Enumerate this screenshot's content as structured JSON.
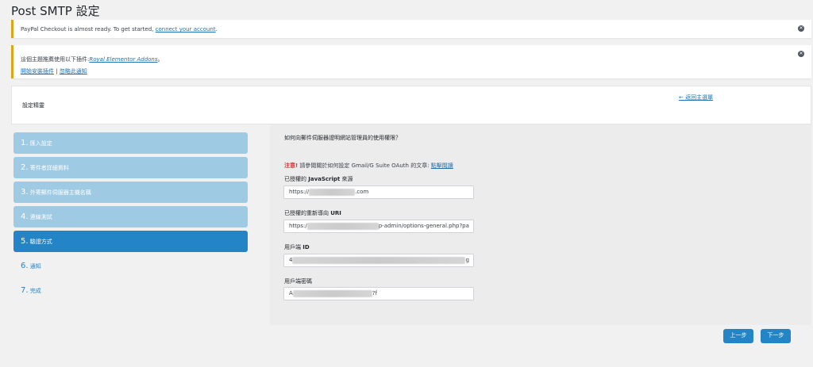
{
  "page": {
    "title": "Post SMTP 設定"
  },
  "notices": {
    "paypal": {
      "text": "PayPal Checkout is almost ready. To get started, ",
      "link": "connect your account",
      "suffix": "."
    },
    "theme": {
      "text": "這個主題推薦使用以下插件:",
      "plugin": "Royal Elementor Addons",
      "suffix": "。",
      "install": "開始安裝插件",
      "separator": " | ",
      "dismiss": "忽略此通知"
    }
  },
  "wizard": {
    "label": "設定精靈",
    "back": "← 返回主選單"
  },
  "steps": [
    {
      "num": "1.",
      "label": "匯入設定",
      "state": "done"
    },
    {
      "num": "2.",
      "label": "寄件者詳細資料",
      "state": "done"
    },
    {
      "num": "3.",
      "label": "外寄郵件伺服器主機名稱",
      "state": "done"
    },
    {
      "num": "4.",
      "label": "連線測試",
      "state": "done"
    },
    {
      "num": "5.",
      "label": "驗證方式",
      "state": "active"
    },
    {
      "num": "6.",
      "label": "通知",
      "state": "todo"
    },
    {
      "num": "7.",
      "label": "完成",
      "state": "todo"
    }
  ],
  "panel": {
    "question": "如何向郵件伺服器證明網站管理員的使用權限？",
    "note_warn": "注意!",
    "note_text": " 請參閱關於如何設定 Gmail/G Suite OAuth 的文章: ",
    "note_link": "點擊閱讀",
    "js_origin": {
      "label_prefix": "已授權的 ",
      "label_bold": "JavaScript",
      "label_suffix": " 來源",
      "value_start": "https://",
      "value_end": ".com"
    },
    "redirect": {
      "label_prefix": "已授權的重新導向 ",
      "label_bold": "URI",
      "value_start": "https:/",
      "value_end": "p-admin/options-general.php?pa"
    },
    "client_id": {
      "label_prefix": "用戶端 ",
      "label_bold": "ID",
      "value_start": "4",
      "value_end": "g"
    },
    "client_secret": {
      "label": "用戶端密碼",
      "value_start": "A",
      "value_end": "?f"
    }
  },
  "buttons": {
    "prev": "上一步",
    "next": "下一步"
  },
  "colors": {
    "step_done": "#9ecae3",
    "step_active": "#2384c6",
    "notice_border": "#dba617",
    "link": "#2271b1"
  }
}
